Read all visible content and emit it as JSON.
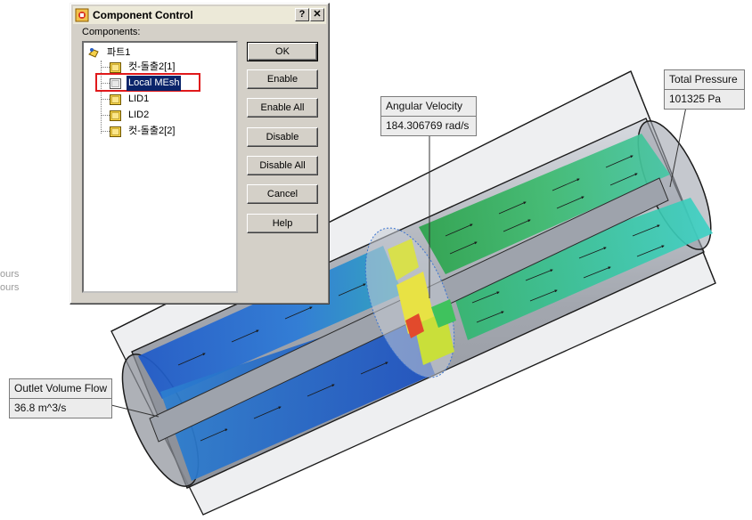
{
  "dialog": {
    "title": "Component Control",
    "help_glyph": "?",
    "close_glyph": "✕",
    "components_label": "Components:",
    "tree": [
      {
        "label": "파트1",
        "icon": "part-icon",
        "level": 0
      },
      {
        "label": "컷-돌출2[1]",
        "icon": "folder-icon",
        "level": 1
      },
      {
        "label": "Local MEsh",
        "icon": "mesh-icon",
        "level": 1,
        "selected": true
      },
      {
        "label": "LID1",
        "icon": "folder-icon",
        "level": 1
      },
      {
        "label": "LID2",
        "icon": "folder-icon",
        "level": 1
      },
      {
        "label": "컷-돌출2[2]",
        "icon": "folder-icon",
        "level": 1
      }
    ],
    "buttons": {
      "ok": "OK",
      "enable": "Enable",
      "enable_all": "Enable All",
      "disable": "Disable",
      "disable_all": "Disable All",
      "cancel": "Cancel",
      "help": "Help"
    }
  },
  "callouts": {
    "angular_velocity": {
      "label": "Angular Velocity",
      "value": "184.306769 rad/s"
    },
    "total_pressure": {
      "label": "Total Pressure",
      "value": "101325 Pa"
    },
    "outlet_volume_flow": {
      "label": "Outlet Volume Flow",
      "value": "36.8 m^3/s"
    }
  },
  "background_text": [
    "ours",
    "ours"
  ],
  "colors": {
    "selection_highlight": "#0a246a",
    "selection_box": "#e0191b",
    "dialog_face": "#d4d0c8"
  }
}
